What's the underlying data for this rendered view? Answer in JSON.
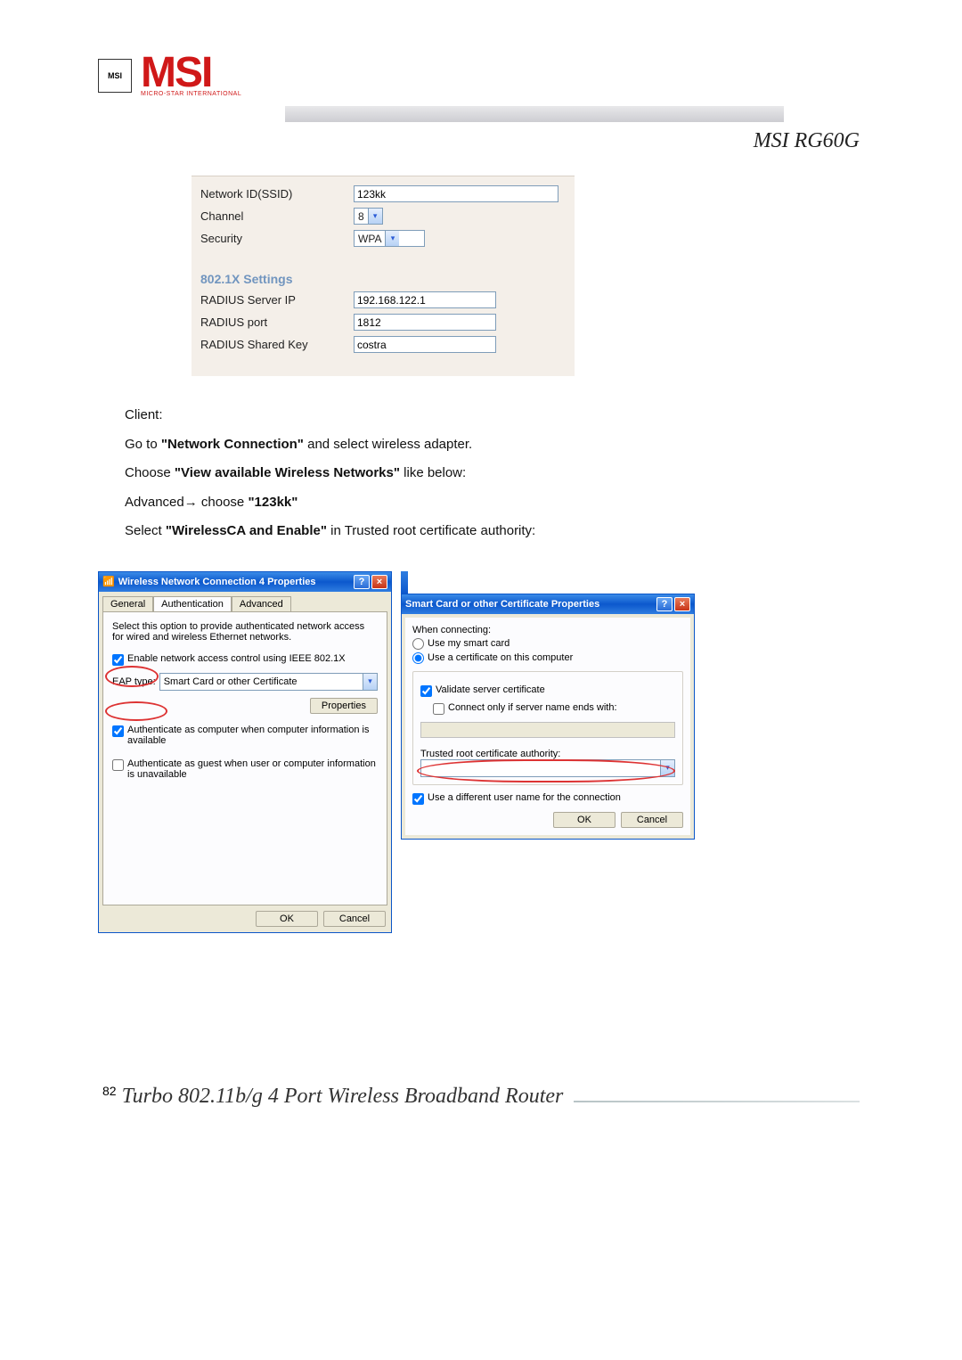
{
  "logo": {
    "brand": "MSI",
    "tagline": "MICRO-STAR INTERNATIONAL"
  },
  "model": "MSI RG60G",
  "settings": {
    "ssid_label": "Network ID(SSID)",
    "ssid_value": "123kk",
    "channel_label": "Channel",
    "channel_value": "8",
    "security_label": "Security",
    "security_value": "WPA",
    "section_title": "802.1X Settings",
    "radius_ip_label": "RADIUS Server IP",
    "radius_ip_value": "192.168.122.1",
    "radius_port_label": "RADIUS port",
    "radius_port_value": "1812",
    "radius_key_label": "RADIUS Shared Key",
    "radius_key_value": "costra"
  },
  "body": {
    "p1": "Client:",
    "p2a": "Go to ",
    "p2b": "\"Network Connection\"",
    "p2c": " and select wireless adapter.",
    "p3a": "Choose ",
    "p3b": "\"View available Wireless Networks\"",
    "p3c": " like below:",
    "p4a": "Advanced",
    "p4arrow": "→",
    "p4b": " choose ",
    "p4c": "\"123kk\"",
    "p5a": "Select ",
    "p5b": "\"WirelessCA and Enable\"",
    "p5c": " in Trusted root certificate authority:"
  },
  "dlg1": {
    "title": "Wireless Network Connection 4 Properties",
    "tab_general": "General",
    "tab_auth": "Authentication",
    "tab_adv": "Advanced",
    "desc": "Select this option to provide authenticated network access for wired and wireless Ethernet networks.",
    "chk_enable": "Enable network access control using IEEE 802.1X",
    "eap_label": "EAP type:",
    "eap_value": "Smart Card or other Certificate",
    "btn_props": "Properties",
    "chk_auth_comp": "Authenticate as computer when computer information is available",
    "chk_auth_guest": "Authenticate as guest when user or computer information is unavailable",
    "ok": "OK",
    "cancel": "Cancel"
  },
  "dlg2": {
    "title": "Smart Card or other Certificate Properties",
    "when_connecting": "When connecting:",
    "use_smart": "Use my smart card",
    "use_cert": "Use a certificate on this computer",
    "validate": "Validate server certificate",
    "connect_only": "Connect only if server name ends with:",
    "trusted_label": "Trusted root certificate authority:",
    "use_diff": "Use a different user name for the connection",
    "ok": "OK",
    "cancel": "Cancel"
  },
  "footer": {
    "page_num": "82",
    "text": "Turbo 802.11b/g 4 Port Wireless Broadband Router"
  }
}
